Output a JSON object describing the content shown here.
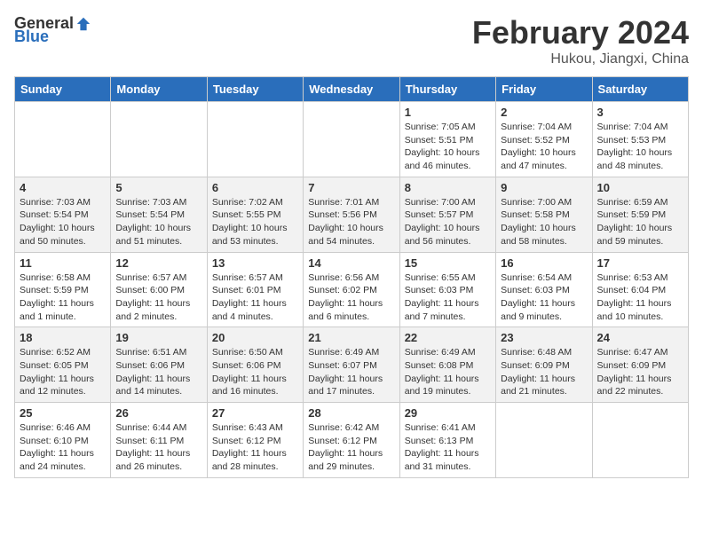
{
  "header": {
    "logo_general": "General",
    "logo_blue": "Blue",
    "title": "February 2024",
    "subtitle": "Hukou, Jiangxi, China"
  },
  "columns": [
    "Sunday",
    "Monday",
    "Tuesday",
    "Wednesday",
    "Thursday",
    "Friday",
    "Saturday"
  ],
  "weeks": [
    [
      {
        "day": "",
        "info": ""
      },
      {
        "day": "",
        "info": ""
      },
      {
        "day": "",
        "info": ""
      },
      {
        "day": "",
        "info": ""
      },
      {
        "day": "1",
        "info": "Sunrise: 7:05 AM\nSunset: 5:51 PM\nDaylight: 10 hours\nand 46 minutes."
      },
      {
        "day": "2",
        "info": "Sunrise: 7:04 AM\nSunset: 5:52 PM\nDaylight: 10 hours\nand 47 minutes."
      },
      {
        "day": "3",
        "info": "Sunrise: 7:04 AM\nSunset: 5:53 PM\nDaylight: 10 hours\nand 48 minutes."
      }
    ],
    [
      {
        "day": "4",
        "info": "Sunrise: 7:03 AM\nSunset: 5:54 PM\nDaylight: 10 hours\nand 50 minutes."
      },
      {
        "day": "5",
        "info": "Sunrise: 7:03 AM\nSunset: 5:54 PM\nDaylight: 10 hours\nand 51 minutes."
      },
      {
        "day": "6",
        "info": "Sunrise: 7:02 AM\nSunset: 5:55 PM\nDaylight: 10 hours\nand 53 minutes."
      },
      {
        "day": "7",
        "info": "Sunrise: 7:01 AM\nSunset: 5:56 PM\nDaylight: 10 hours\nand 54 minutes."
      },
      {
        "day": "8",
        "info": "Sunrise: 7:00 AM\nSunset: 5:57 PM\nDaylight: 10 hours\nand 56 minutes."
      },
      {
        "day": "9",
        "info": "Sunrise: 7:00 AM\nSunset: 5:58 PM\nDaylight: 10 hours\nand 58 minutes."
      },
      {
        "day": "10",
        "info": "Sunrise: 6:59 AM\nSunset: 5:59 PM\nDaylight: 10 hours\nand 59 minutes."
      }
    ],
    [
      {
        "day": "11",
        "info": "Sunrise: 6:58 AM\nSunset: 5:59 PM\nDaylight: 11 hours\nand 1 minute."
      },
      {
        "day": "12",
        "info": "Sunrise: 6:57 AM\nSunset: 6:00 PM\nDaylight: 11 hours\nand 2 minutes."
      },
      {
        "day": "13",
        "info": "Sunrise: 6:57 AM\nSunset: 6:01 PM\nDaylight: 11 hours\nand 4 minutes."
      },
      {
        "day": "14",
        "info": "Sunrise: 6:56 AM\nSunset: 6:02 PM\nDaylight: 11 hours\nand 6 minutes."
      },
      {
        "day": "15",
        "info": "Sunrise: 6:55 AM\nSunset: 6:03 PM\nDaylight: 11 hours\nand 7 minutes."
      },
      {
        "day": "16",
        "info": "Sunrise: 6:54 AM\nSunset: 6:03 PM\nDaylight: 11 hours\nand 9 minutes."
      },
      {
        "day": "17",
        "info": "Sunrise: 6:53 AM\nSunset: 6:04 PM\nDaylight: 11 hours\nand 10 minutes."
      }
    ],
    [
      {
        "day": "18",
        "info": "Sunrise: 6:52 AM\nSunset: 6:05 PM\nDaylight: 11 hours\nand 12 minutes."
      },
      {
        "day": "19",
        "info": "Sunrise: 6:51 AM\nSunset: 6:06 PM\nDaylight: 11 hours\nand 14 minutes."
      },
      {
        "day": "20",
        "info": "Sunrise: 6:50 AM\nSunset: 6:06 PM\nDaylight: 11 hours\nand 16 minutes."
      },
      {
        "day": "21",
        "info": "Sunrise: 6:49 AM\nSunset: 6:07 PM\nDaylight: 11 hours\nand 17 minutes."
      },
      {
        "day": "22",
        "info": "Sunrise: 6:49 AM\nSunset: 6:08 PM\nDaylight: 11 hours\nand 19 minutes."
      },
      {
        "day": "23",
        "info": "Sunrise: 6:48 AM\nSunset: 6:09 PM\nDaylight: 11 hours\nand 21 minutes."
      },
      {
        "day": "24",
        "info": "Sunrise: 6:47 AM\nSunset: 6:09 PM\nDaylight: 11 hours\nand 22 minutes."
      }
    ],
    [
      {
        "day": "25",
        "info": "Sunrise: 6:46 AM\nSunset: 6:10 PM\nDaylight: 11 hours\nand 24 minutes."
      },
      {
        "day": "26",
        "info": "Sunrise: 6:44 AM\nSunset: 6:11 PM\nDaylight: 11 hours\nand 26 minutes."
      },
      {
        "day": "27",
        "info": "Sunrise: 6:43 AM\nSunset: 6:12 PM\nDaylight: 11 hours\nand 28 minutes."
      },
      {
        "day": "28",
        "info": "Sunrise: 6:42 AM\nSunset: 6:12 PM\nDaylight: 11 hours\nand 29 minutes."
      },
      {
        "day": "29",
        "info": "Sunrise: 6:41 AM\nSunset: 6:13 PM\nDaylight: 11 hours\nand 31 minutes."
      },
      {
        "day": "",
        "info": ""
      },
      {
        "day": "",
        "info": ""
      }
    ]
  ]
}
